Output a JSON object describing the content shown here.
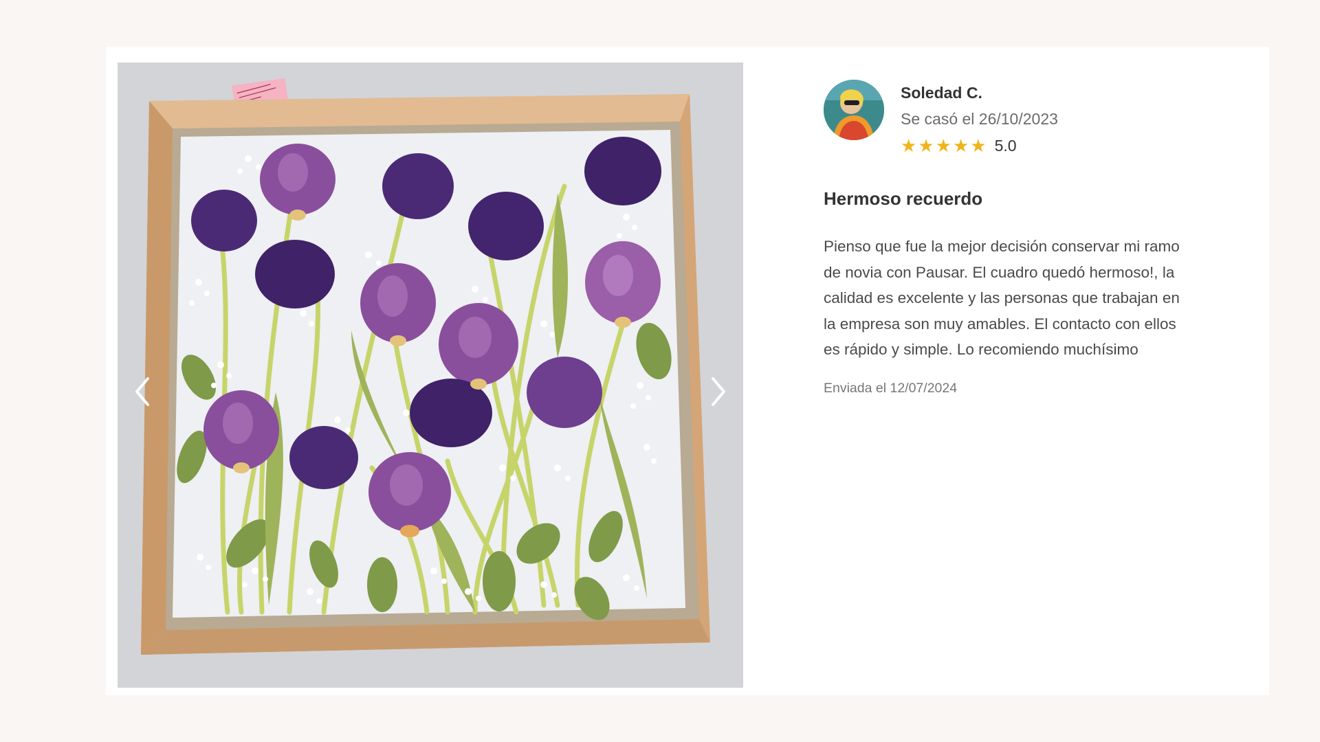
{
  "gallery": {
    "photo_alt": "Cuadro con ramo de novia prensado",
    "prev_icon": "chevron-left-icon",
    "next_icon": "chevron-right-icon",
    "note_label_color": "#f5b3c4",
    "frame_color": "#d4a77a",
    "flower_colors": [
      "#4b2a75",
      "#8a4f9c",
      "#a66bb3"
    ]
  },
  "review": {
    "reviewer_name": "Soledad C.",
    "wedding_date": "Se casó el 26/10/2023",
    "rating_value": "5.0",
    "rating": 5,
    "star_color": "#f0b41b",
    "title": "Hermoso recuerdo",
    "body_lines": [
      "Pienso que fue la mejor decisión conservar mi ramo",
      "de novia con Pausar. El cuadro quedó hermoso!, la",
      "calidad es excelente y las personas que trabajan en",
      "la empresa son muy amables. El contacto con ellos",
      "es rápido y simple. Lo recomiendo muchísimo"
    ],
    "sent_date": "Enviada el 12/07/2024"
  }
}
